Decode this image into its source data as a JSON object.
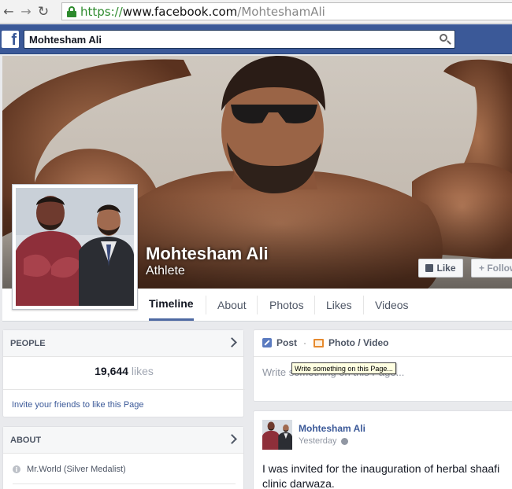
{
  "browser": {
    "url_protocol": "https://",
    "url_domain": "www.facebook.com",
    "url_path": "/MohteshamAli"
  },
  "topbar": {
    "logo_letter": "f",
    "search_value": "Mohtesham Ali"
  },
  "profile": {
    "name": "Mohtesham Ali",
    "category": "Athlete",
    "like_label": "Like",
    "follow_label": "+ Follow"
  },
  "tabs": [
    {
      "label": "Timeline",
      "active": true
    },
    {
      "label": "About",
      "active": false
    },
    {
      "label": "Photos",
      "active": false
    },
    {
      "label": "Likes",
      "active": false
    },
    {
      "label": "Videos",
      "active": false
    }
  ],
  "people": {
    "title": "PEOPLE",
    "count": "19,644",
    "count_label": "likes",
    "invite": "Invite your friends to like this Page"
  },
  "about": {
    "title": "ABOUT",
    "item": "Mr.World (Silver Medalist)"
  },
  "composer": {
    "post_tab": "Post",
    "photo_tab": "Photo / Video",
    "placeholder": "Write something on this Page...",
    "tooltip": "Write something on this Page..."
  },
  "post": {
    "author": "Mohtesham Ali",
    "time": "Yesterday",
    "text": "I was invited for the inauguration of herbal shaafi clinic darwaza."
  },
  "colors": {
    "facebook_blue": "#3b5998",
    "link": "#3b5998",
    "secure_green": "#2e8b2e"
  }
}
